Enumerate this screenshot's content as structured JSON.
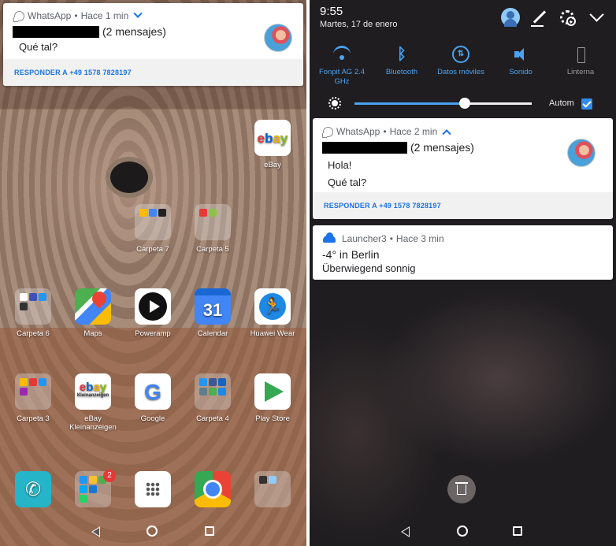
{
  "left_screen": {
    "notification": {
      "app_name": "WhatsApp",
      "time": "Hace 1 min",
      "message_count": "(2 mensajes)",
      "messages": [
        "Qué tal?"
      ],
      "reply_action": "RESPONDER A +49 1578 7828197"
    },
    "apps": [
      {
        "label": "eBay",
        "icon": "ebay-icon"
      },
      {
        "label": "Carpeta 7",
        "icon": "folder-icon"
      },
      {
        "label": "Carpeta 5",
        "icon": "folder-icon"
      },
      {
        "label": "Carpeta 6",
        "icon": "folder-icon"
      },
      {
        "label": "Maps",
        "icon": "maps-icon"
      },
      {
        "label": "Poweramp",
        "icon": "poweramp-icon"
      },
      {
        "label": "Calendar",
        "icon": "calendar-icon",
        "glyph": "31"
      },
      {
        "label": "Huawei Wear",
        "icon": "huawei-wear-icon"
      },
      {
        "label": "Carpeta 3",
        "icon": "folder-icon"
      },
      {
        "label": "eBay Kleinanzeigen",
        "icon": "ebay-kleinanzeigen-icon"
      },
      {
        "label": "Google",
        "icon": "google-icon"
      },
      {
        "label": "Carpeta 4",
        "icon": "folder-icon"
      },
      {
        "label": "Play Store",
        "icon": "play-store-icon"
      }
    ],
    "dock": {
      "messages_badge": "2"
    }
  },
  "right_screen": {
    "status": {
      "time": "9:55",
      "date": "Martes, 17 de enero"
    },
    "quick_settings": [
      {
        "label": "Fonpit AG 2.4 GHz",
        "icon": "wifi-icon",
        "active": true
      },
      {
        "label": "Bluetooth",
        "icon": "bluetooth-icon",
        "active": true
      },
      {
        "label": "Datos móviles",
        "icon": "mobile-data-icon",
        "active": true
      },
      {
        "label": "Sonido",
        "icon": "sound-icon",
        "active": true
      },
      {
        "label": "Linterna",
        "icon": "flashlight-icon",
        "active": false
      }
    ],
    "brightness": {
      "level": 0.62,
      "auto_label": "Autom",
      "auto_checked": true
    },
    "whatsapp_notification": {
      "app_name": "WhatsApp",
      "time": "Hace 2 min",
      "message_count": "(2 mensajes)",
      "messages": [
        "Hola!",
        "Qué tal?"
      ],
      "reply_action": "RESPONDER A +49 1578 7828197"
    },
    "launcher_notification": {
      "app_name": "Launcher3",
      "time": "Hace 3 min",
      "title": "-4° in Berlin",
      "text": "Überwiegend sonnig"
    }
  },
  "colors": {
    "accent": "#1a73e8",
    "quick_settings_active": "#4aa3f0",
    "shade_background": "#1f1d20"
  }
}
